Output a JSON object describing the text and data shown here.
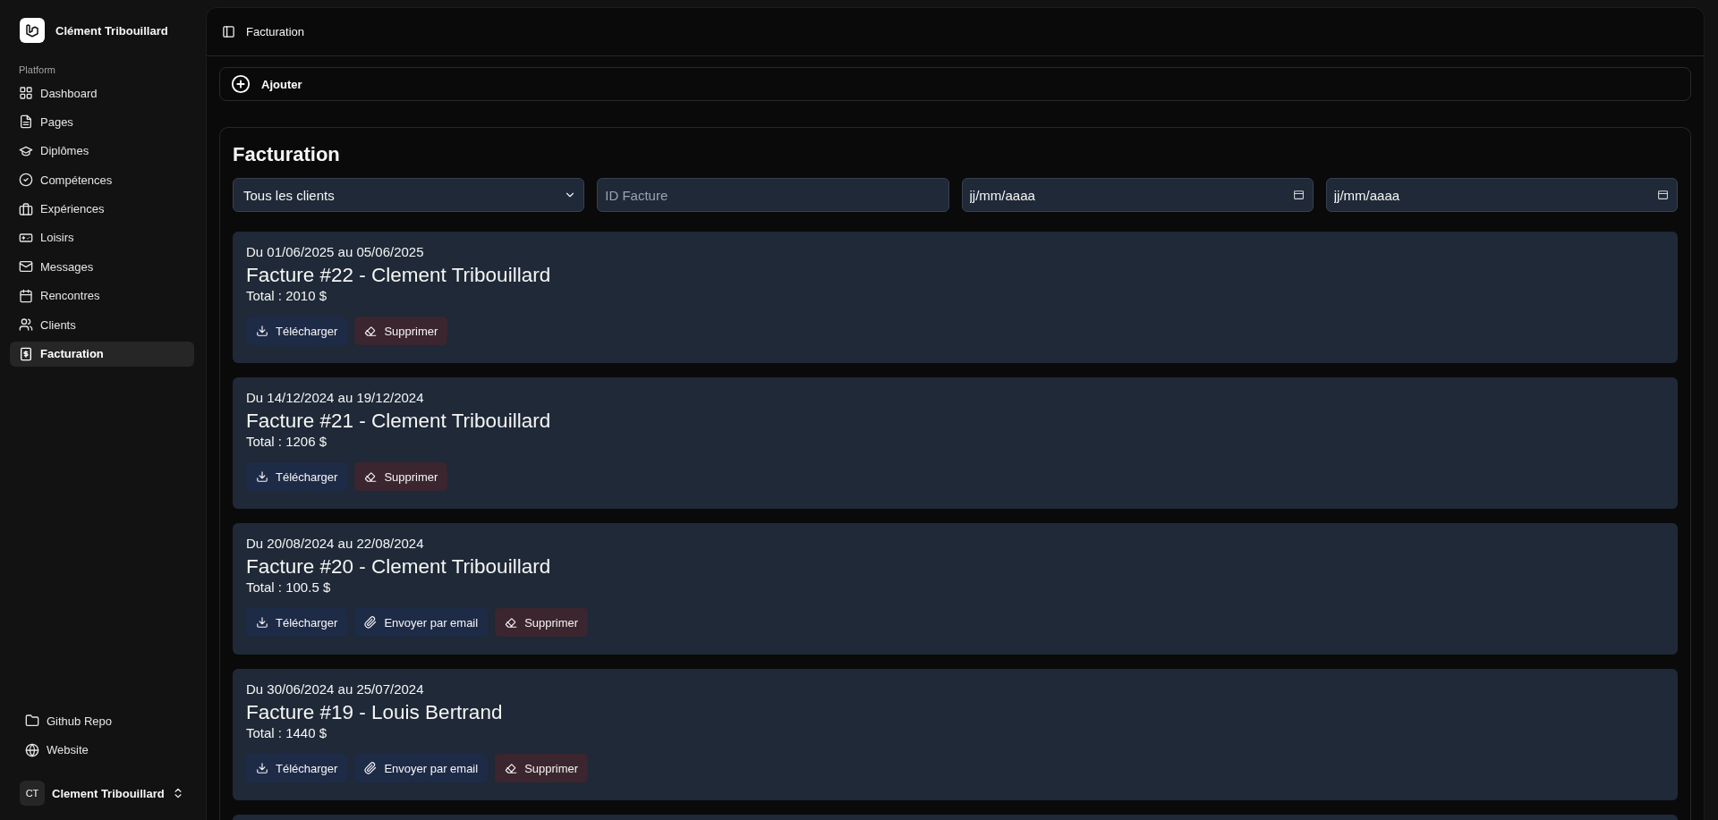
{
  "sidebar": {
    "app_name": "Clément Tribouillard",
    "section": "Platform",
    "items": [
      {
        "label": "Dashboard",
        "selected": false
      },
      {
        "label": "Pages",
        "selected": false
      },
      {
        "label": "Diplômes",
        "selected": false
      },
      {
        "label": "Compétences",
        "selected": false
      },
      {
        "label": "Expériences",
        "selected": false
      },
      {
        "label": "Loisirs",
        "selected": false
      },
      {
        "label": "Messages",
        "selected": false
      },
      {
        "label": "Rencontres",
        "selected": false
      },
      {
        "label": "Clients",
        "selected": false
      },
      {
        "label": "Facturation",
        "selected": true
      }
    ],
    "links": [
      {
        "label": "Github Repo"
      },
      {
        "label": "Website"
      }
    ],
    "user": {
      "initials": "CT",
      "name": "Clement Tribouillard"
    }
  },
  "header": {
    "breadcrumb": "Facturation"
  },
  "add_button": {
    "label": "Ajouter"
  },
  "panel": {
    "title": "Facturation",
    "filters": {
      "client": "Tous les clients",
      "invoice_id": {
        "placeholder": "ID Facture"
      },
      "date_from": {
        "placeholder": "jj/mm/aaaa"
      },
      "date_to": {
        "placeholder": "jj/mm/aaaa"
      }
    },
    "invoices": [
      {
        "period": "Du 01/06/2025 au 05/06/2025",
        "title": "Facture #22 - Clement Tribouillard",
        "total": "Total : 2010 $",
        "actions": [
          {
            "kind": "download",
            "label": "Télécharger"
          },
          {
            "kind": "delete",
            "label": "Supprimer"
          }
        ]
      },
      {
        "period": "Du 14/12/2024 au 19/12/2024",
        "title": "Facture #21 - Clement Tribouillard",
        "total": "Total : 1206 $",
        "actions": [
          {
            "kind": "download",
            "label": "Télécharger"
          },
          {
            "kind": "delete",
            "label": "Supprimer"
          }
        ]
      },
      {
        "period": "Du 20/08/2024 au 22/08/2024",
        "title": "Facture #20 - Clement Tribouillard",
        "total": "Total : 100.5 $",
        "actions": [
          {
            "kind": "download",
            "label": "Télécharger"
          },
          {
            "kind": "email",
            "label": "Envoyer par email"
          },
          {
            "kind": "delete",
            "label": "Supprimer"
          }
        ]
      },
      {
        "period": "Du 30/06/2024 au 25/07/2024",
        "title": "Facture #19 - Louis Bertrand",
        "total": "Total : 1440 $",
        "actions": [
          {
            "kind": "download",
            "label": "Télécharger"
          },
          {
            "kind": "email",
            "label": "Envoyer par email"
          },
          {
            "kind": "delete",
            "label": "Supprimer"
          }
        ]
      }
    ]
  }
}
